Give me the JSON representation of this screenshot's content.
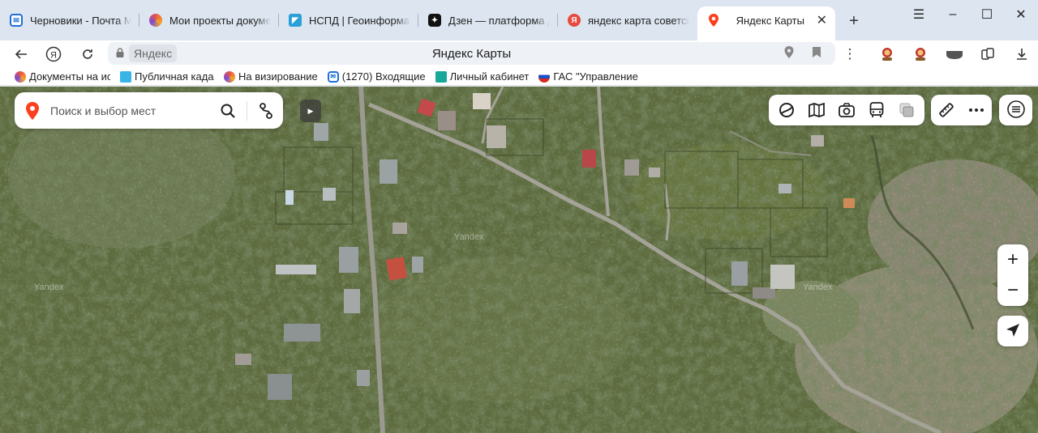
{
  "tabs": [
    {
      "label": "Черновики - Почта Ма",
      "icon": "mail-icon"
    },
    {
      "label": "Мои проекты докумен",
      "icon": "edge-icon"
    },
    {
      "label": "НСПД | Геоинформаци",
      "icon": "nspd-icon"
    },
    {
      "label": "Дзен — платформа дл",
      "icon": "dzen-icon"
    },
    {
      "label": "яндекс карта советск",
      "icon": "yandex-icon"
    },
    {
      "label": "Яндекс Карты",
      "icon": "map-pin-icon",
      "active": true
    }
  ],
  "window_controls": {
    "menu": "☰",
    "minimize": "–",
    "maximize": "☐",
    "close": "✕"
  },
  "address_bar": {
    "host": "Яндекс",
    "page_title": "Яндекс Карты"
  },
  "bookmarks": [
    {
      "label": "Документы на ис",
      "icon": "edge-icon"
    },
    {
      "label": "Публичная кадас",
      "icon": "pub-icon"
    },
    {
      "label": "На визирование",
      "icon": "edge-icon"
    },
    {
      "label": "(1270) Входящие",
      "icon": "mail-icon"
    },
    {
      "label": "Личный кабинет",
      "icon": "cabinet-icon"
    },
    {
      "label": "ГАС \"Управление",
      "icon": "flag-icon"
    }
  ],
  "map": {
    "search_placeholder": "Поиск и выбор мест",
    "watermark": "Yandex",
    "zoom_in": "+",
    "zoom_out": "−"
  },
  "colors": {
    "accent_red": "#fc3f1d",
    "browser_chrome": "#dce5f0"
  }
}
